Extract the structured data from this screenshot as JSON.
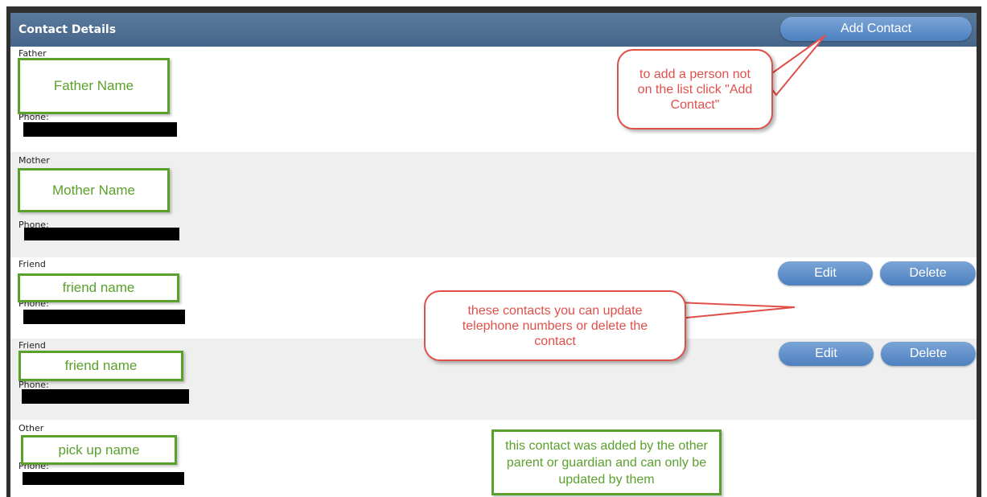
{
  "header": {
    "title": "Contact Details",
    "add_button": "Add Contact"
  },
  "contacts": [
    {
      "relation": "Father",
      "name": "Father Name",
      "phone_label": "Phone:"
    },
    {
      "relation": "Mother",
      "name": "Mother Name",
      "phone_label": "Phone:"
    },
    {
      "relation": "Friend",
      "name": "friend name",
      "phone_label": "Phone:",
      "edit": "Edit",
      "delete": "Delete"
    },
    {
      "relation": "Friend",
      "name": "friend name",
      "phone_label": "Phone:",
      "edit": "Edit",
      "delete": "Delete"
    },
    {
      "relation": "Other",
      "name": "pick up name",
      "phone_label": "Phone:"
    }
  ],
  "annotations": {
    "add_contact_tip": "to add a person not on the list click \"Add Contact\"",
    "update_tip": "these contacts you can update telephone numbers or delete the contact",
    "other_parent_note": "this contact was added by the other parent or guardian and can only be updated by them"
  },
  "colors": {
    "header": "#4a6a8c",
    "button": "#5b8cc8",
    "callout_border": "#e0504a",
    "note_border": "#5aa02c",
    "alt_row": "#efefef"
  }
}
